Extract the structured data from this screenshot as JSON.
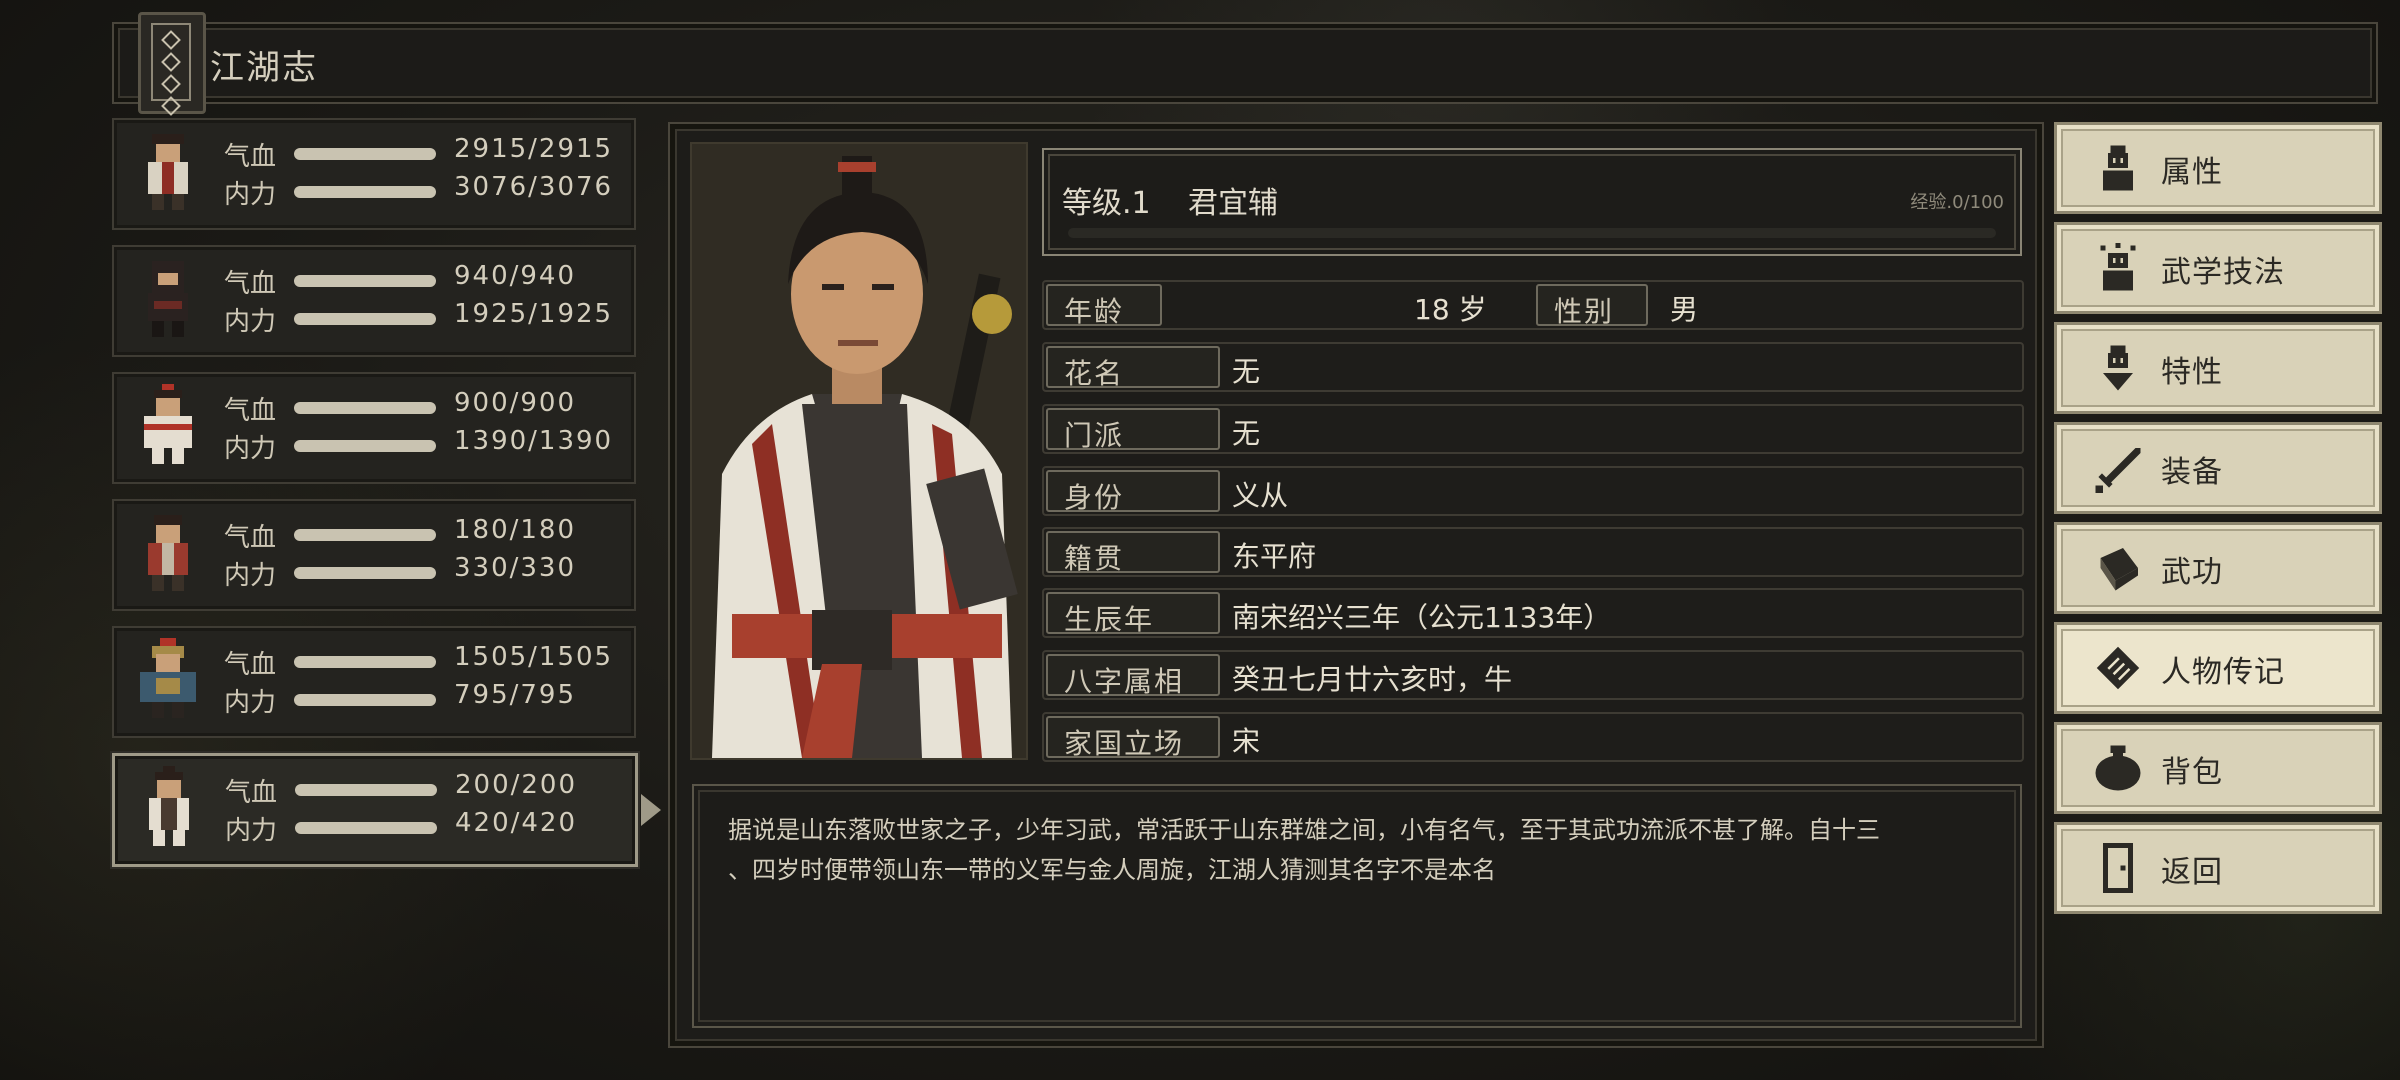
{
  "window": {
    "title": "江湖志"
  },
  "roster": [
    {
      "hp_label": "气血",
      "hp": "2915/2915",
      "mp_label": "内力",
      "mp": "3076/3076",
      "colors": {
        "main": "#8e2d24",
        "robe": "#d9d2c2"
      }
    },
    {
      "hp_label": "气血",
      "hp": "940/940",
      "mp_label": "内力",
      "mp": "1925/1925",
      "colors": {
        "main": "#2a2220",
        "robe": "#6b2a24"
      }
    },
    {
      "hp_label": "气血",
      "hp": "900/900",
      "mp_label": "内力",
      "mp": "1390/1390",
      "colors": {
        "main": "#b03328",
        "robe": "#e4ddd0"
      }
    },
    {
      "hp_label": "气血",
      "hp": "180/180",
      "mp_label": "内力",
      "mp": "330/330",
      "colors": {
        "main": "#9a3a2e",
        "robe": "#c2b7a4"
      }
    },
    {
      "hp_label": "气血",
      "hp": "1505/1505",
      "mp_label": "内力",
      "mp": "795/795",
      "colors": {
        "main": "#3c5a6e",
        "robe": "#a58a48"
      }
    },
    {
      "hp_label": "气血",
      "hp": "200/200",
      "mp_label": "内力",
      "mp": "420/420",
      "colors": {
        "main": "#4a3a30",
        "robe": "#e4ddd0"
      },
      "active": true
    }
  ],
  "character": {
    "level": "等级.1",
    "name": "君宜辅",
    "exp": "经验.0/100",
    "age_label": "年龄",
    "age_value": "18 岁",
    "gender_label": "性别",
    "gender_value": "男",
    "rows": [
      {
        "label": "花名",
        "value": "无"
      },
      {
        "label": "门派",
        "value": "无"
      },
      {
        "label": "身份",
        "value": "义从"
      },
      {
        "label": "籍贯",
        "value": "东平府"
      },
      {
        "label": "生辰年",
        "value": "南宋绍兴三年（公元1133年）"
      },
      {
        "label": "八字属相",
        "value": "癸丑七月廿六亥时，牛"
      },
      {
        "label": "家国立场",
        "value": "宋"
      }
    ],
    "bio_line1": "据说是山东落败世家之子，少年习武，常活跃于山东群雄之间，小有名气，至于其武功流派不甚了解。自十三",
    "bio_line2": "、四岁时便带领山东一带的义军与金人周旋，江湖人猜测其名字不是本名"
  },
  "menu": [
    {
      "label": "属性",
      "icon": "person-stats-icon"
    },
    {
      "label": "武学技法",
      "icon": "martial-arts-icon"
    },
    {
      "label": "特性",
      "icon": "traits-icon"
    },
    {
      "label": "装备",
      "icon": "sword-icon"
    },
    {
      "label": "武功",
      "icon": "manual-book-icon"
    },
    {
      "label": "人物传记",
      "icon": "biography-scroll-icon",
      "active": true
    },
    {
      "label": "背包",
      "icon": "bag-icon"
    },
    {
      "label": "返回",
      "icon": "door-exit-icon"
    }
  ]
}
